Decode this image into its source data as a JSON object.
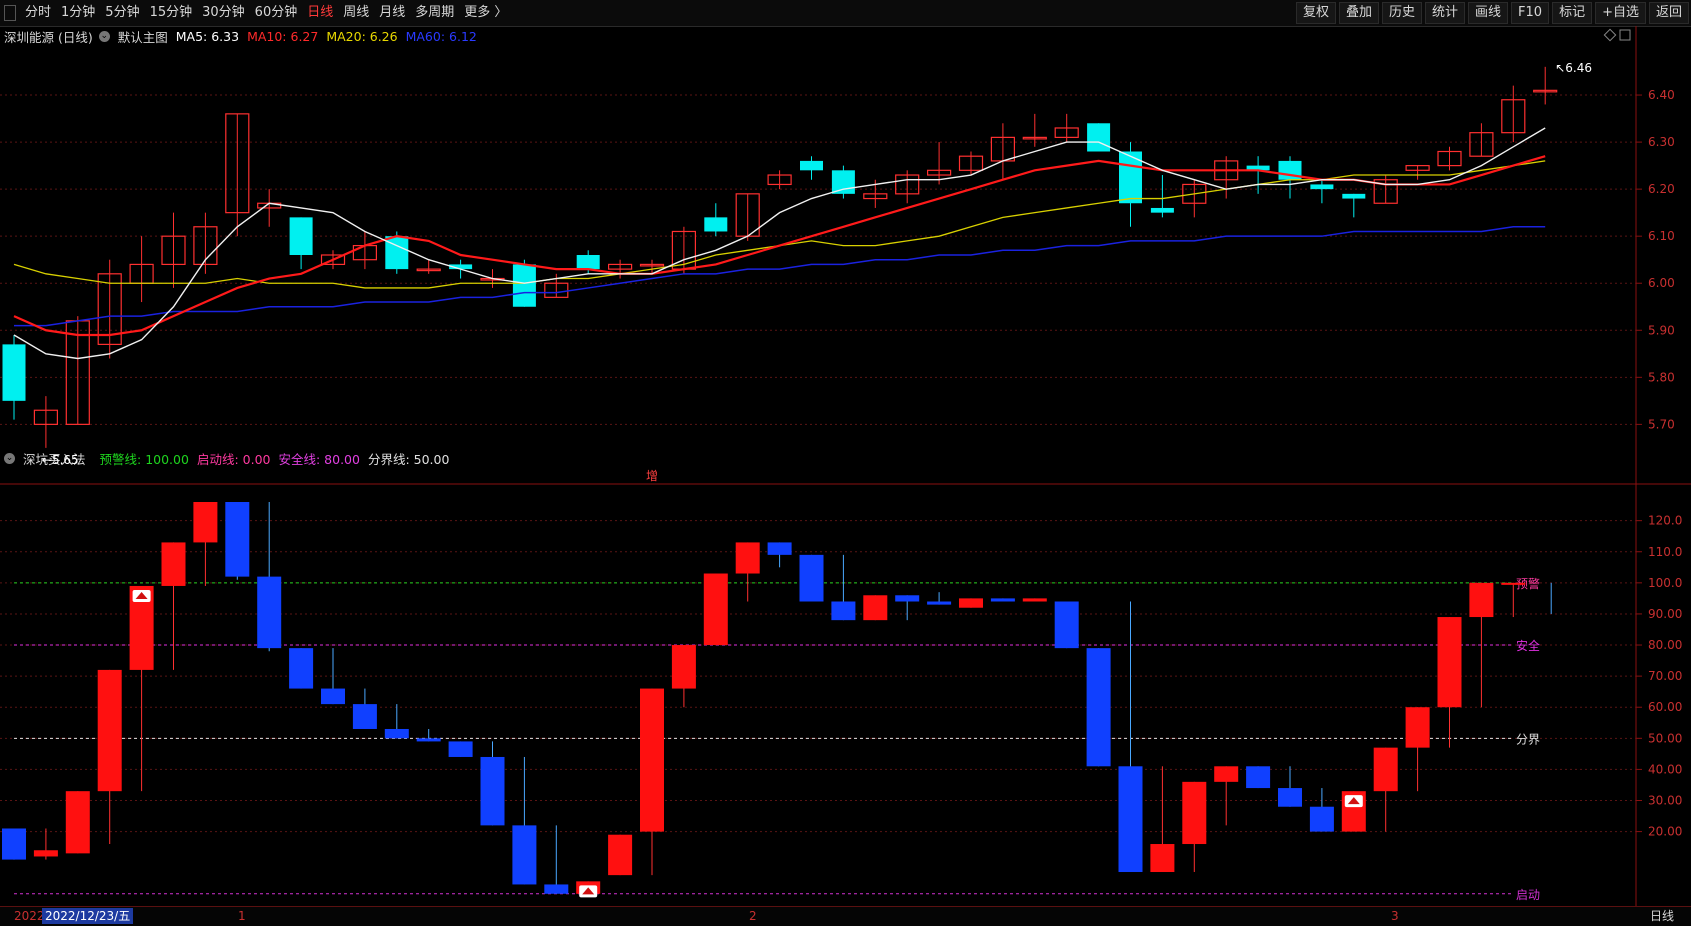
{
  "toolbar": {
    "periods": [
      "分时",
      "1分钟",
      "5分钟",
      "15分钟",
      "30分钟",
      "60分钟",
      "日线",
      "周线",
      "月线",
      "多周期",
      "更多 〉"
    ],
    "active_period": "日线",
    "right_buttons": [
      "复权",
      "叠加",
      "历史",
      "统计",
      "画线",
      "F10",
      "标记",
      "+自选",
      "返回"
    ]
  },
  "main_panel": {
    "title": "深圳能源 (日线)",
    "template": "默认主图",
    "ma": [
      {
        "label": "MA5: 6.33",
        "color": "#ffffff"
      },
      {
        "label": "MA10: 6.27",
        "color": "#ff2a2a"
      },
      {
        "label": "MA20: 6.26",
        "color": "#e8d800"
      },
      {
        "label": "MA60: 6.12",
        "color": "#2a3aff"
      }
    ],
    "high_label": "6.46",
    "low_label": "5.65",
    "marker": "增",
    "price_ticks": [
      "6.40",
      "6.30",
      "6.20",
      "6.10",
      "6.00",
      "5.90",
      "5.80",
      "5.70"
    ]
  },
  "sub_panel": {
    "title": "深坑买入法",
    "params": [
      {
        "label": "预警线: 100.00",
        "color": "#1ed41e"
      },
      {
        "label": "启动线: 0.00",
        "color": "#ff3aa0"
      },
      {
        "label": "安全线: 80.00",
        "color": "#e040e0"
      },
      {
        "label": "分界线: 50.00",
        "color": "#e0e0e0"
      }
    ],
    "line_labels": {
      "warn": "预警",
      "safe": "安全",
      "divide": "分界",
      "start": "启动"
    },
    "ticks": [
      "120.0",
      "110.0",
      "100.0",
      "90.00",
      "80.00",
      "70.00",
      "60.00",
      "50.00",
      "40.00",
      "30.00",
      "20.00"
    ]
  },
  "bottom": {
    "year": "2022",
    "cursor_date": "2022/12/23/五",
    "month_marks": [
      "1",
      "2",
      "3"
    ],
    "period_label": "日线"
  },
  "chart_data": {
    "type": "candlestick",
    "price": {
      "ylim": [
        5.62,
        6.5
      ],
      "candles": [
        [
          5.87,
          5.75,
          5.89,
          5.71
        ],
        [
          5.7,
          5.73,
          5.76,
          5.65
        ],
        [
          5.7,
          5.92,
          5.93,
          5.7
        ],
        [
          5.87,
          6.02,
          6.05,
          5.84
        ],
        [
          6.0,
          6.04,
          6.1,
          5.96
        ],
        [
          6.04,
          6.1,
          6.15,
          5.99
        ],
        [
          6.04,
          6.12,
          6.15,
          6.02
        ],
        [
          6.15,
          6.36,
          6.36,
          6.1
        ],
        [
          6.16,
          6.17,
          6.2,
          6.12
        ],
        [
          6.14,
          6.06,
          6.14,
          6.03
        ],
        [
          6.04,
          6.06,
          6.07,
          6.03
        ],
        [
          6.05,
          6.08,
          6.11,
          6.03
        ],
        [
          6.1,
          6.03,
          6.11,
          6.02
        ],
        [
          6.03,
          6.03,
          6.05,
          6.02
        ],
        [
          6.04,
          6.03,
          6.05,
          6.01
        ],
        [
          6.01,
          6.01,
          6.03,
          5.99
        ],
        [
          6.04,
          5.95,
          6.05,
          5.95
        ],
        [
          5.97,
          6.0,
          6.02,
          5.97
        ],
        [
          6.06,
          6.03,
          6.07,
          6.02
        ],
        [
          6.03,
          6.04,
          6.05,
          6.01
        ],
        [
          6.04,
          6.04,
          6.05,
          6.02
        ],
        [
          6.03,
          6.11,
          6.12,
          6.02
        ],
        [
          6.14,
          6.11,
          6.17,
          6.1
        ],
        [
          6.1,
          6.19,
          6.19,
          6.09
        ],
        [
          6.21,
          6.23,
          6.24,
          6.2
        ],
        [
          6.26,
          6.24,
          6.27,
          6.22
        ],
        [
          6.24,
          6.19,
          6.25,
          6.18
        ],
        [
          6.18,
          6.19,
          6.22,
          6.16
        ],
        [
          6.19,
          6.23,
          6.24,
          6.17
        ],
        [
          6.23,
          6.24,
          6.3,
          6.21
        ],
        [
          6.24,
          6.27,
          6.28,
          6.23
        ],
        [
          6.26,
          6.31,
          6.34,
          6.22
        ],
        [
          6.31,
          6.31,
          6.36,
          6.29
        ],
        [
          6.31,
          6.33,
          6.36,
          6.3
        ],
        [
          6.34,
          6.28,
          6.34,
          6.28
        ],
        [
          6.28,
          6.17,
          6.3,
          6.12
        ],
        [
          6.16,
          6.15,
          6.23,
          6.14
        ],
        [
          6.17,
          6.21,
          6.22,
          6.14
        ],
        [
          6.22,
          6.26,
          6.27,
          6.18
        ],
        [
          6.25,
          6.24,
          6.27,
          6.19
        ],
        [
          6.26,
          6.22,
          6.27,
          6.18
        ],
        [
          6.21,
          6.2,
          6.22,
          6.17
        ],
        [
          6.19,
          6.18,
          6.19,
          6.14
        ],
        [
          6.17,
          6.22,
          6.23,
          6.17
        ],
        [
          6.24,
          6.25,
          6.25,
          6.22
        ],
        [
          6.25,
          6.28,
          6.29,
          6.24
        ],
        [
          6.27,
          6.32,
          6.34,
          6.27
        ],
        [
          6.32,
          6.39,
          6.42,
          6.3
        ],
        [
          6.41,
          6.41,
          6.46,
          6.38
        ]
      ],
      "ma5": [
        5.89,
        5.85,
        5.84,
        5.85,
        5.88,
        5.95,
        6.05,
        6.12,
        6.17,
        6.16,
        6.15,
        6.11,
        6.08,
        6.05,
        6.03,
        6.01,
        6.0,
        6.01,
        6.02,
        6.02,
        6.02,
        6.05,
        6.07,
        6.1,
        6.15,
        6.18,
        6.2,
        6.21,
        6.22,
        6.22,
        6.23,
        6.26,
        6.28,
        6.3,
        6.3,
        6.27,
        6.24,
        6.22,
        6.2,
        6.21,
        6.21,
        6.22,
        6.22,
        6.21,
        6.21,
        6.22,
        6.25,
        6.29,
        6.33
      ],
      "ma10": [
        5.93,
        5.9,
        5.89,
        5.89,
        5.9,
        5.93,
        5.96,
        5.99,
        6.01,
        6.02,
        6.05,
        6.08,
        6.1,
        6.09,
        6.06,
        6.05,
        6.04,
        6.03,
        6.03,
        6.02,
        6.02,
        6.03,
        6.04,
        6.06,
        6.08,
        6.1,
        6.12,
        6.14,
        6.16,
        6.18,
        6.2,
        6.22,
        6.24,
        6.25,
        6.26,
        6.25,
        6.24,
        6.24,
        6.24,
        6.24,
        6.23,
        6.22,
        6.22,
        6.21,
        6.21,
        6.21,
        6.23,
        6.25,
        6.27
      ],
      "ma20": [
        6.04,
        6.02,
        6.01,
        6.0,
        6.0,
        6.0,
        6.0,
        6.01,
        6.0,
        6.0,
        6.0,
        5.99,
        5.99,
        5.99,
        6.0,
        6.0,
        6.0,
        6.01,
        6.01,
        6.02,
        6.03,
        6.04,
        6.06,
        6.07,
        6.08,
        6.09,
        6.08,
        6.08,
        6.09,
        6.1,
        6.12,
        6.14,
        6.15,
        6.16,
        6.17,
        6.18,
        6.18,
        6.19,
        6.2,
        6.21,
        6.22,
        6.22,
        6.23,
        6.23,
        6.23,
        6.23,
        6.24,
        6.25,
        6.26
      ],
      "ma60": [
        5.91,
        5.91,
        5.92,
        5.93,
        5.93,
        5.94,
        5.94,
        5.94,
        5.95,
        5.95,
        5.95,
        5.96,
        5.96,
        5.96,
        5.97,
        5.97,
        5.98,
        5.98,
        5.99,
        6.0,
        6.01,
        6.02,
        6.02,
        6.03,
        6.03,
        6.04,
        6.04,
        6.05,
        6.05,
        6.06,
        6.06,
        6.07,
        6.07,
        6.08,
        6.08,
        6.09,
        6.09,
        6.09,
        6.1,
        6.1,
        6.1,
        6.1,
        6.11,
        6.11,
        6.11,
        6.11,
        6.11,
        6.12,
        6.12
      ]
    },
    "indicator": {
      "ylim": [
        -2,
        126
      ],
      "levels": {
        "warn": 100,
        "safe": 80,
        "divide": 50,
        "start": 0
      },
      "bars": [
        [
          21,
          11,
          21,
          11
        ],
        [
          12,
          14,
          21,
          11
        ],
        [
          13,
          33,
          33,
          13
        ],
        [
          33,
          72,
          72,
          16
        ],
        [
          72,
          99,
          99,
          33
        ],
        [
          99,
          113,
          113,
          72
        ],
        [
          113,
          126,
          126,
          99
        ],
        [
          126,
          102,
          126,
          101
        ],
        [
          102,
          79,
          126,
          78
        ],
        [
          79,
          66,
          79,
          66
        ],
        [
          66,
          61,
          79,
          61
        ],
        [
          61,
          53,
          66,
          53
        ],
        [
          53,
          50,
          61,
          50
        ],
        [
          50,
          49,
          53,
          49
        ],
        [
          49,
          44,
          49,
          44
        ],
        [
          44,
          22,
          49,
          22
        ],
        [
          22,
          3,
          44,
          3
        ],
        [
          3,
          0,
          22,
          0
        ],
        [
          0,
          4,
          4,
          0
        ],
        [
          6,
          19,
          19,
          6
        ],
        [
          20,
          66,
          66,
          6
        ],
        [
          66,
          80,
          80,
          60
        ],
        [
          80,
          103,
          103,
          80
        ],
        [
          103,
          113,
          113,
          94
        ],
        [
          113,
          109,
          113,
          105
        ],
        [
          109,
          94,
          109,
          94
        ],
        [
          94,
          88,
          109,
          88
        ],
        [
          88,
          96,
          96,
          88
        ],
        [
          96,
          94,
          96,
          88
        ],
        [
          94,
          93,
          97,
          93
        ],
        [
          92,
          95,
          95,
          92
        ],
        [
          95,
          94,
          95,
          94
        ],
        [
          94,
          95,
          95,
          94
        ],
        [
          94,
          79,
          94,
          79
        ],
        [
          79,
          41,
          79,
          41
        ],
        [
          41,
          7,
          94,
          7
        ],
        [
          7,
          16,
          41,
          7
        ],
        [
          16,
          36,
          36,
          7
        ],
        [
          36,
          41,
          41,
          22
        ],
        [
          41,
          34,
          41,
          34
        ],
        [
          34,
          28,
          41,
          28
        ],
        [
          28,
          20,
          34,
          20
        ],
        [
          20,
          33,
          33,
          20
        ],
        [
          33,
          47,
          47,
          20
        ],
        [
          47,
          60,
          60,
          33
        ],
        [
          60,
          89,
          89,
          47
        ],
        [
          89,
          100,
          100,
          60
        ],
        [
          100,
          100,
          100,
          89
        ]
      ],
      "star_indices": [
        4,
        18,
        42
      ]
    }
  }
}
